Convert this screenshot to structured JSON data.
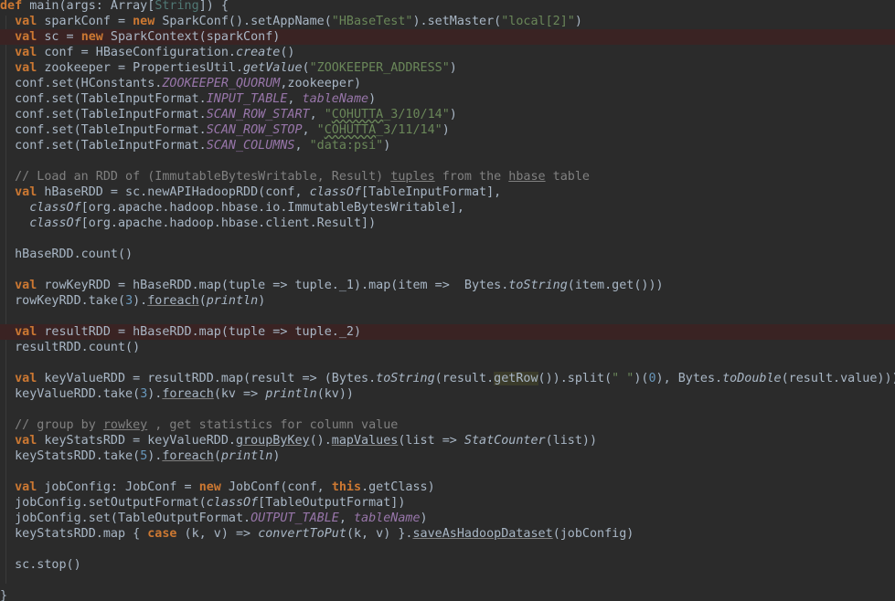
{
  "editor": {
    "lines": [
      {
        "id": "def-main",
        "hl": false,
        "segs": [
          {
            "t": "def",
            "c": "kw"
          },
          {
            "t": " main(args: Array["
          },
          {
            "t": "String",
            "c": "tp"
          },
          {
            "t": "]) {"
          }
        ]
      },
      {
        "id": "spark-conf",
        "hl": false,
        "segs": [
          {
            "t": "  "
          },
          {
            "t": "val",
            "c": "kw"
          },
          {
            "t": " sparkConf = "
          },
          {
            "t": "new",
            "c": "kw"
          },
          {
            "t": " SparkConf().setAppName("
          },
          {
            "t": "\"HBaseTest\"",
            "c": "str"
          },
          {
            "t": ").setMaster("
          },
          {
            "t": "\"local[2]\"",
            "c": "str"
          },
          {
            "t": ")"
          }
        ]
      },
      {
        "id": "spark-context",
        "hl": true,
        "segs": [
          {
            "t": "  "
          },
          {
            "t": "val",
            "c": "kw"
          },
          {
            "t": " sc = "
          },
          {
            "t": "new",
            "c": "kw"
          },
          {
            "t": " SparkContext(sparkConf)"
          }
        ]
      },
      {
        "id": "hbase-conf",
        "hl": false,
        "segs": [
          {
            "t": "  "
          },
          {
            "t": "val",
            "c": "kw"
          },
          {
            "t": " conf = HBaseConfiguration."
          },
          {
            "t": "create",
            "c": "it"
          },
          {
            "t": "()"
          }
        ]
      },
      {
        "id": "zookeeper",
        "hl": false,
        "segs": [
          {
            "t": "  "
          },
          {
            "t": "val",
            "c": "kw"
          },
          {
            "t": " zookeeper = PropertiesUtil."
          },
          {
            "t": "getValue",
            "c": "it"
          },
          {
            "t": "("
          },
          {
            "t": "\"ZOOKEEPER_ADDRESS\"",
            "c": "str"
          },
          {
            "t": ")"
          }
        ]
      },
      {
        "id": "conf-quorum",
        "hl": false,
        "segs": [
          {
            "t": "  conf.set(HConstants."
          },
          {
            "t": "ZOOKEEPER_QUORUM",
            "c": "fld"
          },
          {
            "t": ",zookeeper)"
          }
        ]
      },
      {
        "id": "conf-input-table",
        "hl": false,
        "segs": [
          {
            "t": "  conf.set(TableInputFormat."
          },
          {
            "t": "INPUT_TABLE",
            "c": "fld"
          },
          {
            "t": ", "
          },
          {
            "t": "tableName",
            "c": "fld"
          },
          {
            "t": ")"
          }
        ]
      },
      {
        "id": "conf-row-start",
        "hl": false,
        "segs": [
          {
            "t": "  conf.set(TableInputFormat."
          },
          {
            "t": "SCAN_ROW_START",
            "c": "fld"
          },
          {
            "t": ", "
          },
          {
            "t": "\"",
            "c": "str"
          },
          {
            "t": "COHUTTA",
            "c": "str sq"
          },
          {
            "t": "_3/10/14\"",
            "c": "str"
          },
          {
            "t": ")"
          }
        ]
      },
      {
        "id": "conf-row-stop",
        "hl": false,
        "segs": [
          {
            "t": "  conf.set(TableInputFormat."
          },
          {
            "t": "SCAN_ROW_STOP",
            "c": "fld"
          },
          {
            "t": ", "
          },
          {
            "t": "\"",
            "c": "str"
          },
          {
            "t": "COHUTTA",
            "c": "str sq"
          },
          {
            "t": "_3/11/14\"",
            "c": "str"
          },
          {
            "t": ")"
          }
        ]
      },
      {
        "id": "conf-columns",
        "hl": false,
        "segs": [
          {
            "t": "  conf.set(TableInputFormat."
          },
          {
            "t": "SCAN_COLUMNS",
            "c": "fld"
          },
          {
            "t": ", "
          },
          {
            "t": "\"data:psi\"",
            "c": "str"
          },
          {
            "t": ")"
          }
        ]
      },
      {
        "id": "blank-1",
        "hl": false,
        "segs": []
      },
      {
        "id": "comment-load-rdd",
        "hl": false,
        "segs": [
          {
            "t": "  // Load an RDD of (ImmutableBytesWritable, Result) ",
            "c": "cm"
          },
          {
            "t": "tuples",
            "c": "cm ul"
          },
          {
            "t": " from the ",
            "c": "cm"
          },
          {
            "t": "hbase",
            "c": "cm ul"
          },
          {
            "t": " table",
            "c": "cm"
          }
        ]
      },
      {
        "id": "hbase-rdd",
        "hl": false,
        "segs": [
          {
            "t": "  "
          },
          {
            "t": "val",
            "c": "kw"
          },
          {
            "t": " hBaseRDD = sc.newAPIHadoopRDD(conf, "
          },
          {
            "t": "classOf",
            "c": "it"
          },
          {
            "t": "[TableInputFormat],"
          }
        ]
      },
      {
        "id": "hbase-rdd-arg2",
        "hl": false,
        "segs": [
          {
            "t": "    "
          },
          {
            "t": "classOf",
            "c": "it"
          },
          {
            "t": "[org.apache.hadoop.hbase.io.ImmutableBytesWritable],"
          }
        ]
      },
      {
        "id": "hbase-rdd-arg3",
        "hl": false,
        "segs": [
          {
            "t": "    "
          },
          {
            "t": "classOf",
            "c": "it"
          },
          {
            "t": "[org.apache.hadoop.hbase.client.Result])"
          }
        ]
      },
      {
        "id": "blank-2",
        "hl": false,
        "segs": []
      },
      {
        "id": "hbase-rdd-count",
        "hl": false,
        "segs": [
          {
            "t": "  hBaseRDD.count()"
          }
        ]
      },
      {
        "id": "blank-3",
        "hl": false,
        "segs": []
      },
      {
        "id": "rowkey-rdd",
        "hl": false,
        "segs": [
          {
            "t": "  "
          },
          {
            "t": "val",
            "c": "kw"
          },
          {
            "t": " rowKeyRDD = hBaseRDD.map(tuple => tuple._1).map(item =>  Bytes."
          },
          {
            "t": "toString",
            "c": "it"
          },
          {
            "t": "(item.get()))"
          }
        ]
      },
      {
        "id": "rowkey-take",
        "hl": false,
        "segs": [
          {
            "t": "  rowKeyRDD.take("
          },
          {
            "t": "3",
            "c": "num"
          },
          {
            "t": ")."
          },
          {
            "t": "foreach",
            "c": "ul"
          },
          {
            "t": "("
          },
          {
            "t": "println",
            "c": "it"
          },
          {
            "t": ")"
          }
        ]
      },
      {
        "id": "blank-4",
        "hl": false,
        "segs": []
      },
      {
        "id": "result-rdd",
        "hl": true,
        "segs": [
          {
            "t": "  "
          },
          {
            "t": "val",
            "c": "kw"
          },
          {
            "t": " resultRDD = hBaseRDD.map(tuple => tuple._2)"
          }
        ]
      },
      {
        "id": "result-count",
        "hl": false,
        "segs": [
          {
            "t": "  resultRDD.count()"
          }
        ]
      },
      {
        "id": "blank-5",
        "hl": false,
        "segs": []
      },
      {
        "id": "keyvalue-rdd",
        "hl": false,
        "segs": [
          {
            "t": "  "
          },
          {
            "t": "val",
            "c": "kw"
          },
          {
            "t": " keyValueRDD = resultRDD.map(result => (Bytes."
          },
          {
            "t": "toString",
            "c": "it"
          },
          {
            "t": "(result."
          },
          {
            "t": "getRow",
            "c": "mk"
          },
          {
            "t": "()).split("
          },
          {
            "t": "\" \"",
            "c": "str"
          },
          {
            "t": ")("
          },
          {
            "t": "0",
            "c": "num"
          },
          {
            "t": "), Bytes."
          },
          {
            "t": "toDouble",
            "c": "it"
          },
          {
            "t": "(result.value)))"
          }
        ]
      },
      {
        "id": "keyvalue-take",
        "hl": false,
        "segs": [
          {
            "t": "  keyValueRDD.take("
          },
          {
            "t": "3",
            "c": "num"
          },
          {
            "t": ")."
          },
          {
            "t": "foreach",
            "c": "ul"
          },
          {
            "t": "(kv => "
          },
          {
            "t": "println",
            "c": "it"
          },
          {
            "t": "(kv))"
          }
        ]
      },
      {
        "id": "blank-6",
        "hl": false,
        "segs": []
      },
      {
        "id": "comment-group",
        "hl": false,
        "segs": [
          {
            "t": "  // group by ",
            "c": "cm"
          },
          {
            "t": "rowkey",
            "c": "cm ul"
          },
          {
            "t": " , get statistics for column value",
            "c": "cm"
          }
        ]
      },
      {
        "id": "keystats-rdd",
        "hl": false,
        "segs": [
          {
            "t": "  "
          },
          {
            "t": "val",
            "c": "kw"
          },
          {
            "t": " keyStatsRDD = keyValueRDD."
          },
          {
            "t": "groupByKey",
            "c": "ul"
          },
          {
            "t": "()."
          },
          {
            "t": "mapValues",
            "c": "ul"
          },
          {
            "t": "(list => "
          },
          {
            "t": "StatCounter",
            "c": "it"
          },
          {
            "t": "(list))"
          }
        ]
      },
      {
        "id": "keystats-take",
        "hl": false,
        "segs": [
          {
            "t": "  keyStatsRDD.take("
          },
          {
            "t": "5",
            "c": "num"
          },
          {
            "t": ")."
          },
          {
            "t": "foreach",
            "c": "ul"
          },
          {
            "t": "("
          },
          {
            "t": "println",
            "c": "it"
          },
          {
            "t": ")"
          }
        ]
      },
      {
        "id": "blank-7",
        "hl": false,
        "segs": []
      },
      {
        "id": "job-config",
        "hl": false,
        "segs": [
          {
            "t": "  "
          },
          {
            "t": "val",
            "c": "kw"
          },
          {
            "t": " jobConfig: JobConf = "
          },
          {
            "t": "new",
            "c": "kw"
          },
          {
            "t": " JobConf(conf, "
          },
          {
            "t": "this",
            "c": "kw"
          },
          {
            "t": ".getClass)"
          }
        ]
      },
      {
        "id": "job-output-format",
        "hl": false,
        "segs": [
          {
            "t": "  jobConfig.setOutputFormat("
          },
          {
            "t": "classOf",
            "c": "it"
          },
          {
            "t": "[TableOutputFormat])"
          }
        ]
      },
      {
        "id": "job-output-table",
        "hl": false,
        "segs": [
          {
            "t": "  jobConfig.set(TableOutputFormat."
          },
          {
            "t": "OUTPUT_TABLE",
            "c": "fld"
          },
          {
            "t": ", "
          },
          {
            "t": "tableName",
            "c": "fld"
          },
          {
            "t": ")"
          }
        ]
      },
      {
        "id": "keystats-save",
        "hl": false,
        "segs": [
          {
            "t": "  keyStatsRDD.map { "
          },
          {
            "t": "case",
            "c": "kw"
          },
          {
            "t": " (k, v) => "
          },
          {
            "t": "convertToPut",
            "c": "it"
          },
          {
            "t": "(k, v) }."
          },
          {
            "t": "saveAsHadoopDataset",
            "c": "ul"
          },
          {
            "t": "(jobConfig)"
          }
        ]
      },
      {
        "id": "blank-8",
        "hl": false,
        "segs": []
      },
      {
        "id": "sc-stop",
        "hl": false,
        "segs": [
          {
            "t": "  sc.stop()"
          }
        ]
      },
      {
        "id": "blank-9",
        "hl": false,
        "segs": []
      },
      {
        "id": "close-brace",
        "hl": false,
        "segs": [
          {
            "t": "}"
          }
        ]
      }
    ]
  }
}
